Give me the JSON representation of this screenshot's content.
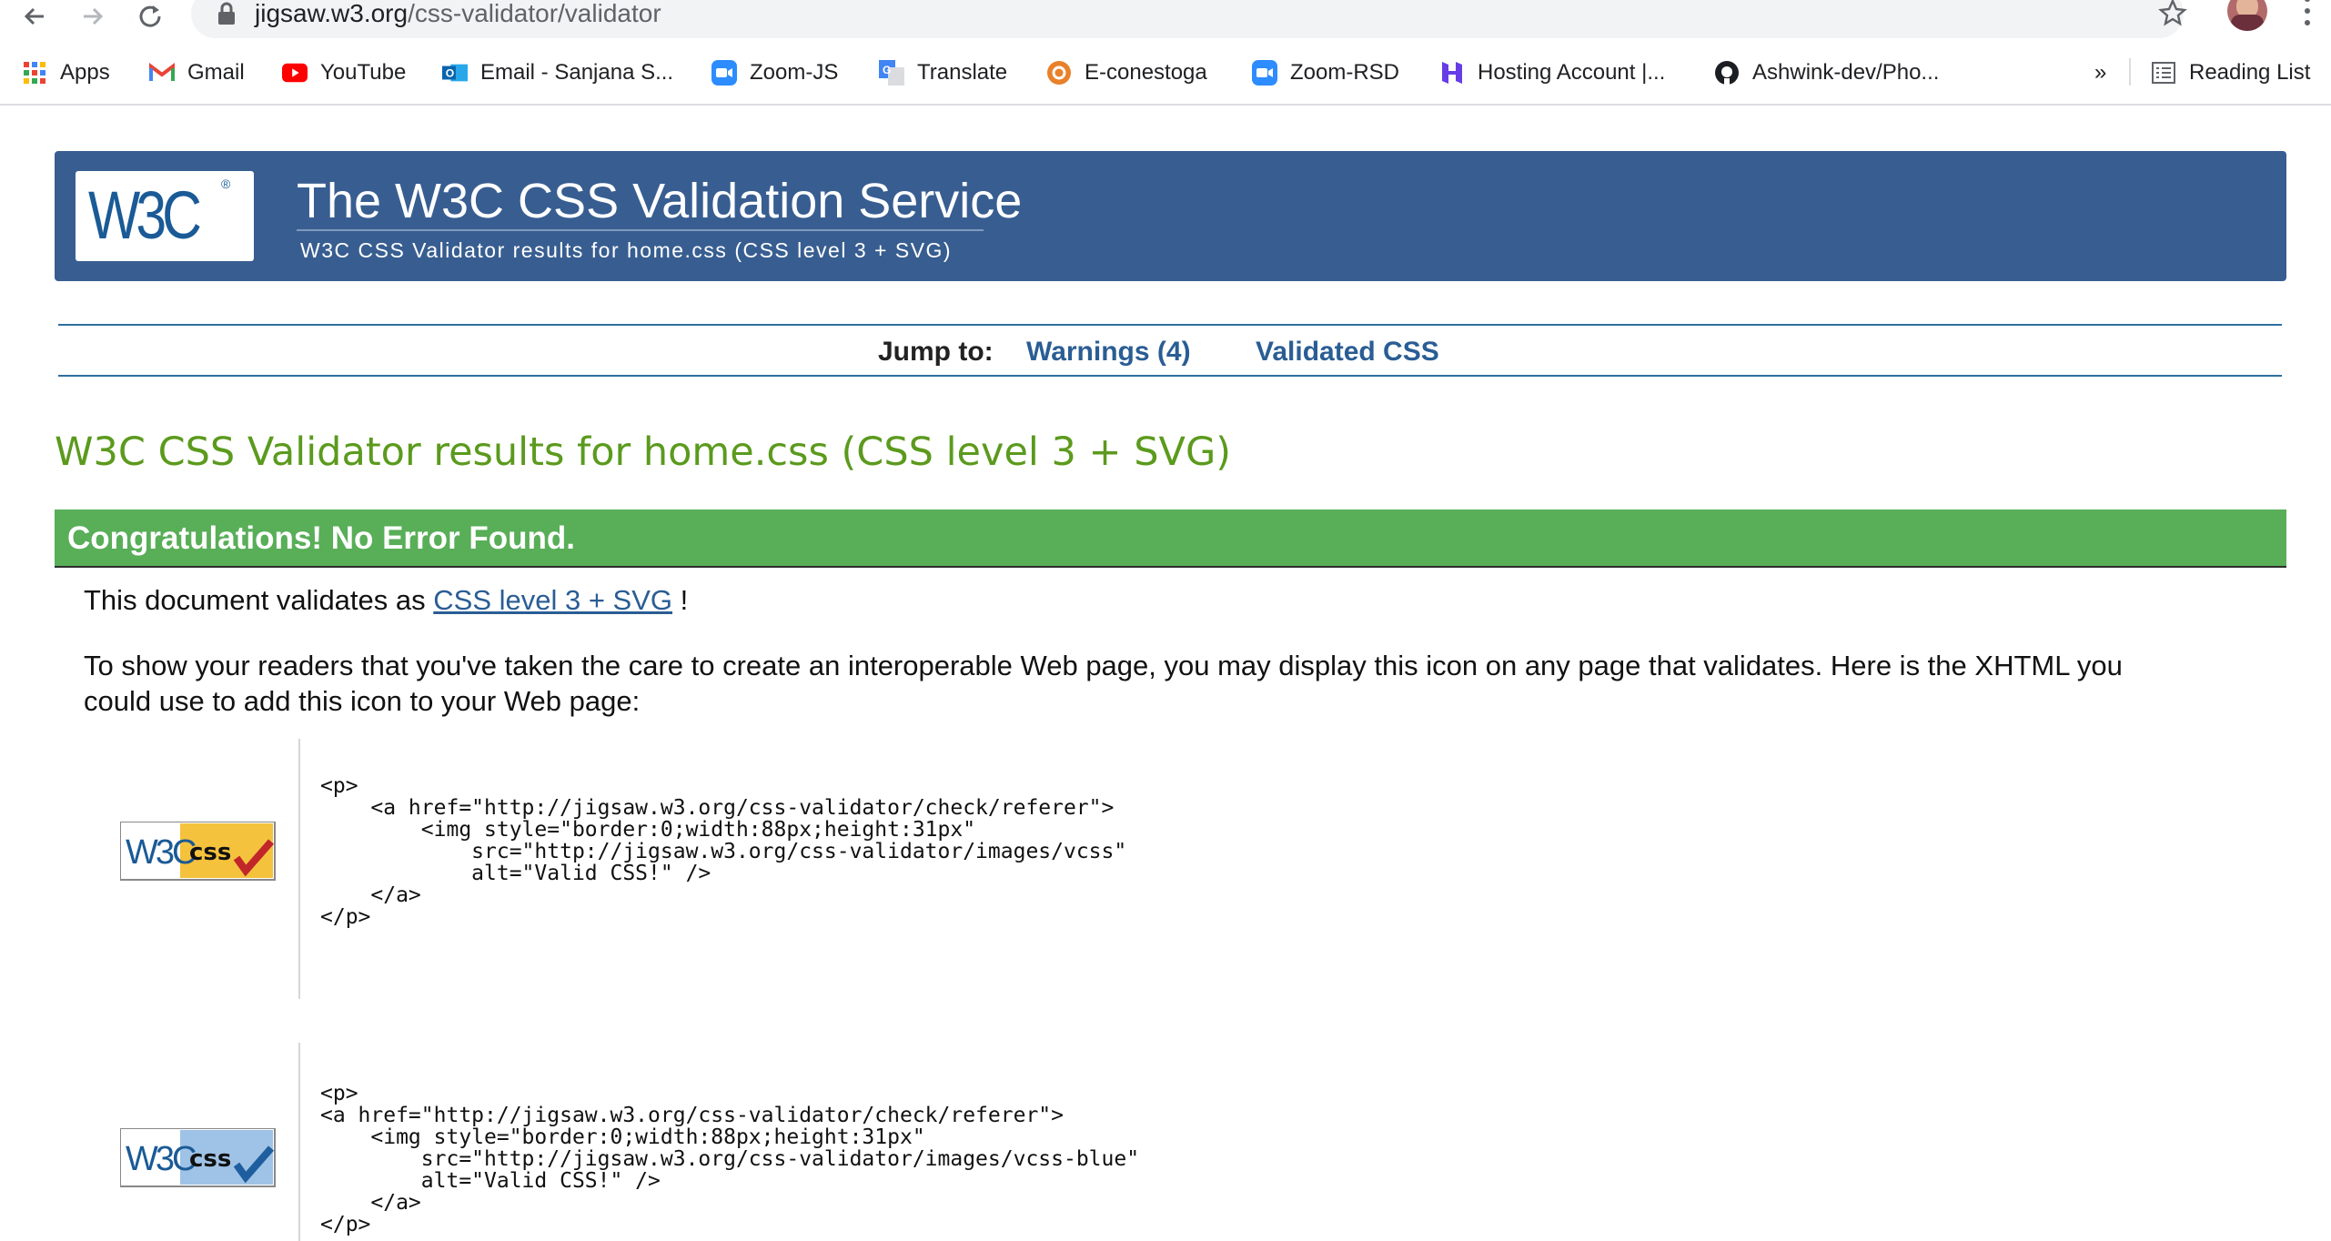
{
  "browser": {
    "url_host": "jigsaw.w3.org",
    "url_path": "/css-validator/validator",
    "bookmarks": [
      {
        "label": "Apps",
        "icon": "apps-grid-icon"
      },
      {
        "label": "Gmail",
        "icon": "gmail-icon"
      },
      {
        "label": "YouTube",
        "icon": "youtube-icon"
      },
      {
        "label": "Email - Sanjana S...",
        "icon": "outlook-icon"
      },
      {
        "label": "Zoom-JS",
        "icon": "zoom-icon"
      },
      {
        "label": "Translate",
        "icon": "translate-icon"
      },
      {
        "label": "E-conestoga",
        "icon": "econestoga-icon"
      },
      {
        "label": "Zoom-RSD",
        "icon": "zoom-icon"
      },
      {
        "label": "Hosting Account |...",
        "icon": "hostinger-icon"
      },
      {
        "label": "Ashwink-dev/Pho...",
        "icon": "github-icon"
      }
    ],
    "overflow": "»",
    "reading_list": "Reading List"
  },
  "banner": {
    "logo_text": "W3C",
    "logo_reg": "®",
    "title": "The W3C CSS Validation Service",
    "subtitle": "W3C CSS Validator results for home.css (CSS level 3 + SVG)"
  },
  "jump": {
    "label": "Jump to:",
    "warnings": "Warnings (4)",
    "validated": "Validated CSS"
  },
  "results": {
    "title": "W3C CSS Validator results for home.css (CSS level 3 + SVG)",
    "congrats": "Congratulations! No Error Found.",
    "validates_prefix": "This document validates as",
    "validates_link": "CSS level 3 + SVG",
    "validates_suffix": "!",
    "icon_text_line1": "To show your readers that you've taken the care to create an interoperable Web page, you may display this icon on any page that validates. Here is the XHTML you",
    "icon_text_line2": "could use to add this icon to your Web page:"
  },
  "snippets": [
    {
      "badge_w3c": "W3C",
      "badge_css": "css",
      "badge_color": "#f5c23d",
      "check_color": "#c0262a",
      "code": "<p>\n    <a href=\"http://jigsaw.w3.org/css-validator/check/referer\">\n        <img style=\"border:0;width:88px;height:31px\"\n            src=\"http://jigsaw.w3.org/css-validator/images/vcss\"\n            alt=\"Valid CSS!\" />\n    </a>\n</p>"
    },
    {
      "badge_w3c": "W3C",
      "badge_css": "css",
      "badge_color": "#9fc3e6",
      "check_color": "#1f5e9e",
      "code": "<p>\n<a href=\"http://jigsaw.w3.org/css-validator/check/referer\">\n    <img style=\"border:0;width:88px;height:31px\"\n        src=\"http://jigsaw.w3.org/css-validator/images/vcss-blue\"\n        alt=\"Valid CSS!\" />\n    </a>\n</p>"
    }
  ],
  "colors": {
    "banner_blue": "#385e91",
    "link_blue": "#2a5d94",
    "results_green": "#5b9a1d",
    "congrats_green": "#59ae58"
  }
}
